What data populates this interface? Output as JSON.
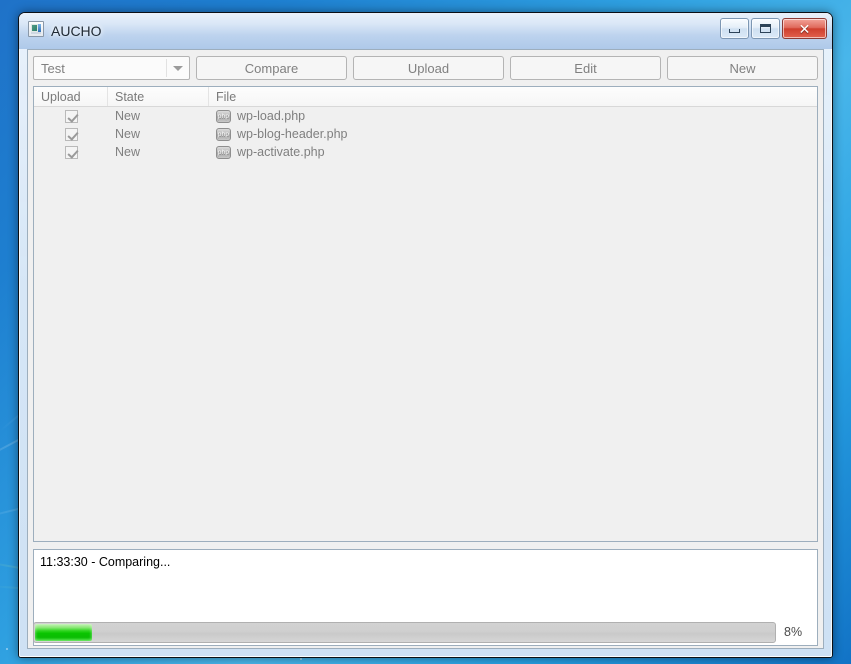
{
  "window": {
    "title": "AUCHO",
    "app_icon": "app-window-icon",
    "controls": {
      "minimize": "minimize-icon",
      "maximize": "maximize-icon",
      "close": "✕"
    }
  },
  "toolbar": {
    "profile_select": {
      "value": "Test",
      "arrow": "chevron-down-icon"
    },
    "buttons": [
      {
        "label": "Compare"
      },
      {
        "label": "Upload"
      },
      {
        "label": "Edit"
      },
      {
        "label": "New"
      }
    ]
  },
  "table": {
    "columns": [
      "Upload",
      "State",
      "File"
    ],
    "rows": [
      {
        "upload_checked": true,
        "state": "New",
        "file": "wp-load.php",
        "file_icon": "php-file-icon"
      },
      {
        "upload_checked": true,
        "state": "New",
        "file": "wp-blog-header.php",
        "file_icon": "php-file-icon"
      },
      {
        "upload_checked": true,
        "state": "New",
        "file": "wp-activate.php",
        "file_icon": "php-file-icon"
      }
    ]
  },
  "log": {
    "lines": [
      "11:33:30 - Comparing..."
    ]
  },
  "progress": {
    "percent": 8,
    "percent_label": "8%",
    "fill_color": "#09c400"
  }
}
